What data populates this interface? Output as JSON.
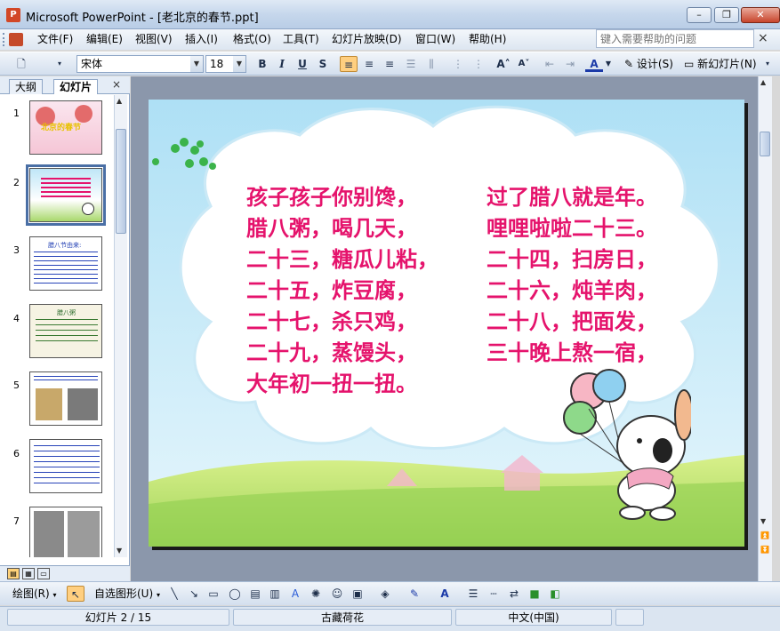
{
  "window": {
    "title": "Microsoft PowerPoint - [老北京的春节.ppt]",
    "minimize": "–",
    "restore": "❐",
    "close": "✕"
  },
  "menubar": {
    "items": [
      "文件(F)",
      "编辑(E)",
      "视图(V)",
      "插入(I)",
      "格式(O)",
      "工具(T)",
      "幻灯片放映(D)",
      "窗口(W)",
      "帮助(H)"
    ],
    "help_placeholder": "键入需要帮助的问题",
    "doc_close": "×"
  },
  "toolbar": {
    "font_name": "宋体",
    "font_size": "18",
    "bold": "B",
    "italic": "I",
    "underline": "U",
    "shadow": "S",
    "font_color": "A",
    "design_label": "设计(S)",
    "new_slide_label": "新幻灯片(N)"
  },
  "left_pane": {
    "tab_outline": "大纲",
    "tab_slides": "幻灯片",
    "close": "×",
    "thumbnails": [
      {
        "num": "1",
        "title": "北京的春节"
      },
      {
        "num": "2",
        "title": ""
      },
      {
        "num": "3",
        "title": "腊八节由来:"
      },
      {
        "num": "4",
        "title": "腊八粥"
      },
      {
        "num": "5",
        "title": ""
      },
      {
        "num": "6",
        "title": ""
      },
      {
        "num": "7",
        "title": ""
      }
    ],
    "selected_slide": "2"
  },
  "slide": {
    "lines": [
      {
        "left": "孩子孩子你别馋，",
        "right": "过了腊八就是年。"
      },
      {
        "left": "腊八粥，喝几天，",
        "right": "哩哩啦啦二十三。"
      },
      {
        "left": "二十三，糖瓜儿粘，",
        "right": "二十四，扫房日，"
      },
      {
        "left": "二十五，炸豆腐，",
        "right": "二十六，炖羊肉，"
      },
      {
        "left": "二十七，杀只鸡，",
        "right": "二十八，把面发，"
      },
      {
        "left": "二十九，蒸馒头，",
        "right": "三十晚上熬一宿，"
      },
      {
        "left": "大年初一扭一扭。",
        "right": ""
      }
    ],
    "text_color": "#e5136c"
  },
  "drawbar": {
    "draw_label": "绘图(R)",
    "autoshapes_label": "自选图形(U)"
  },
  "statusbar": {
    "slide_info": "幻灯片 2 / 15",
    "design_name": "古藏荷花",
    "language": "中文(中国)"
  }
}
